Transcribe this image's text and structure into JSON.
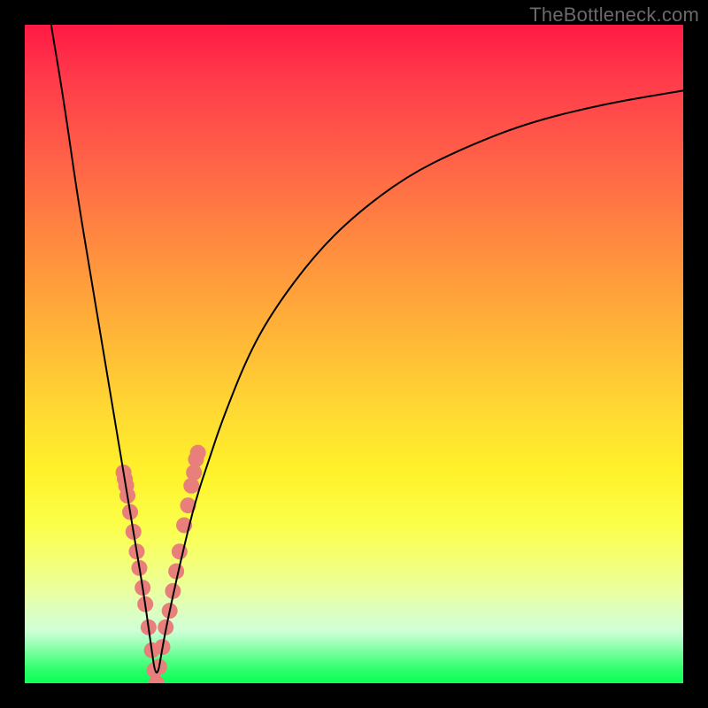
{
  "watermark": "TheBottleneck.com",
  "chart_data": {
    "type": "line",
    "title": "",
    "xlabel": "",
    "ylabel": "",
    "xlim": [
      0,
      100
    ],
    "ylim": [
      0,
      100
    ],
    "optimum_x": 20,
    "curve": {
      "x": [
        4,
        6,
        8,
        10,
        12,
        14,
        15,
        16,
        17,
        18,
        19,
        20,
        21,
        22,
        24,
        26,
        28,
        30,
        34,
        38,
        44,
        50,
        58,
        66,
        76,
        88,
        100
      ],
      "y": [
        100,
        88,
        74,
        62,
        50,
        38,
        32,
        26,
        20,
        14,
        7,
        0,
        6,
        11,
        20,
        28,
        34,
        40,
        50,
        57,
        65,
        71,
        77,
        81,
        85,
        88,
        90
      ]
    },
    "highlight_points": {
      "x": [
        15,
        15.2,
        15.4,
        15.6,
        16,
        16.5,
        17,
        17.4,
        17.9,
        18.3,
        18.8,
        19.3,
        19.7,
        20,
        20.4,
        20.9,
        21.4,
        22,
        22.5,
        23,
        23.5,
        24.2,
        24.8,
        25.3,
        25.7,
        26,
        26.3
      ],
      "y": [
        32,
        31,
        30,
        28.5,
        26,
        23,
        20,
        17.5,
        14.5,
        12,
        8.5,
        5,
        2,
        0,
        2.5,
        5.5,
        8.5,
        11,
        14,
        17,
        20,
        24,
        27,
        30,
        32,
        34,
        35
      ],
      "color": "#e87f7b",
      "radius": 9
    },
    "curve_color": "#000000",
    "curve_width": 2
  }
}
